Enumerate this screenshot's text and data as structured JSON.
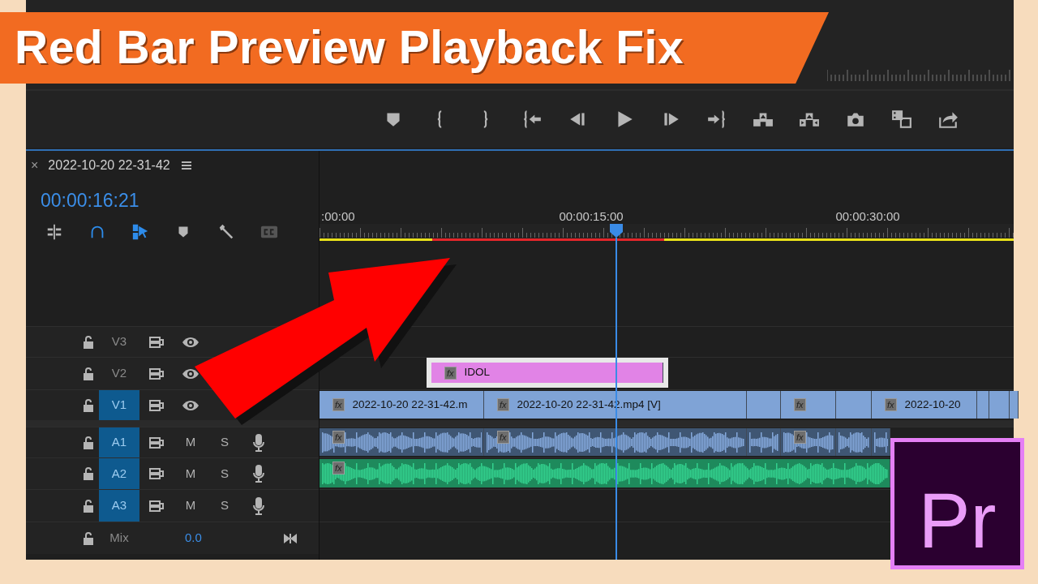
{
  "title_banner": {
    "text": "Red Bar Preview Playback Fix"
  },
  "sequence_tab": {
    "close": "×",
    "name": "2022-10-20 22-31-42"
  },
  "timecode": "00:00:16:21",
  "tools": [
    {
      "kind": "insert",
      "on": false,
      "disabled": false
    },
    {
      "kind": "snap",
      "on": true,
      "disabled": false
    },
    {
      "kind": "linked",
      "on": true,
      "disabled": false
    },
    {
      "kind": "marker",
      "on": false,
      "disabled": false
    },
    {
      "kind": "wrench",
      "on": false,
      "disabled": false
    },
    {
      "kind": "captions",
      "on": false,
      "disabled": true
    }
  ],
  "ruler": {
    "labels": [
      ":00:00",
      "00:00:15:00",
      "00:00:30:00"
    ],
    "render_bar": [
      {
        "color": "#e8e01a",
        "level": 0.162
      },
      {
        "color": "#e4262a",
        "level": 0.335
      },
      {
        "color": "#e8e01a",
        "level": 0.503
      }
    ]
  },
  "playhead": {
    "level": 0.428
  },
  "tracks": [
    {
      "kind": "video",
      "name": "V3",
      "targeted": false
    },
    {
      "kind": "video",
      "name": "V2",
      "targeted": false,
      "clips": [
        {
          "kind": "graphic",
          "label": "IDOL",
          "badge": "fx"
        }
      ]
    },
    {
      "kind": "video",
      "name": "V1",
      "targeted": true,
      "clips": [
        {
          "kind": "video",
          "label": "2022-10-20 22-31-42.m",
          "badge": "fx"
        },
        {
          "kind": "video",
          "label": "2022-10-20 22-31-42.mp4 [V]",
          "badge": "fx"
        },
        {
          "kind": "video"
        },
        {
          "kind": "video",
          "badge": "fx"
        },
        {
          "kind": "video"
        },
        {
          "kind": "video",
          "label": "2022-10-20",
          "badge": "fx"
        },
        {
          "kind": "video"
        },
        {
          "kind": "video"
        },
        {
          "kind": "video"
        }
      ]
    },
    {
      "kind": "audio",
      "name": "A1",
      "targeted": true,
      "mute": "M",
      "solo": "S",
      "clips": [
        {
          "kind": "audio",
          "badge": "fx"
        },
        {
          "kind": "audio",
          "badge": "fx"
        },
        {
          "kind": "audio"
        },
        {
          "kind": "audio",
          "badge": "fx"
        },
        {
          "kind": "audio"
        },
        {
          "kind": "audio"
        }
      ]
    },
    {
      "kind": "audio",
      "name": "A2",
      "targeted": true,
      "mute": "M",
      "solo": "S",
      "clips": [
        {
          "kind": "audio-green",
          "badge": "fx"
        }
      ]
    },
    {
      "kind": "audio",
      "name": "A3",
      "targeted": true,
      "mute": "M",
      "solo": "S"
    }
  ],
  "mix": {
    "label": "Mix",
    "value": "0.0"
  },
  "logo": {
    "text": "Pr"
  }
}
